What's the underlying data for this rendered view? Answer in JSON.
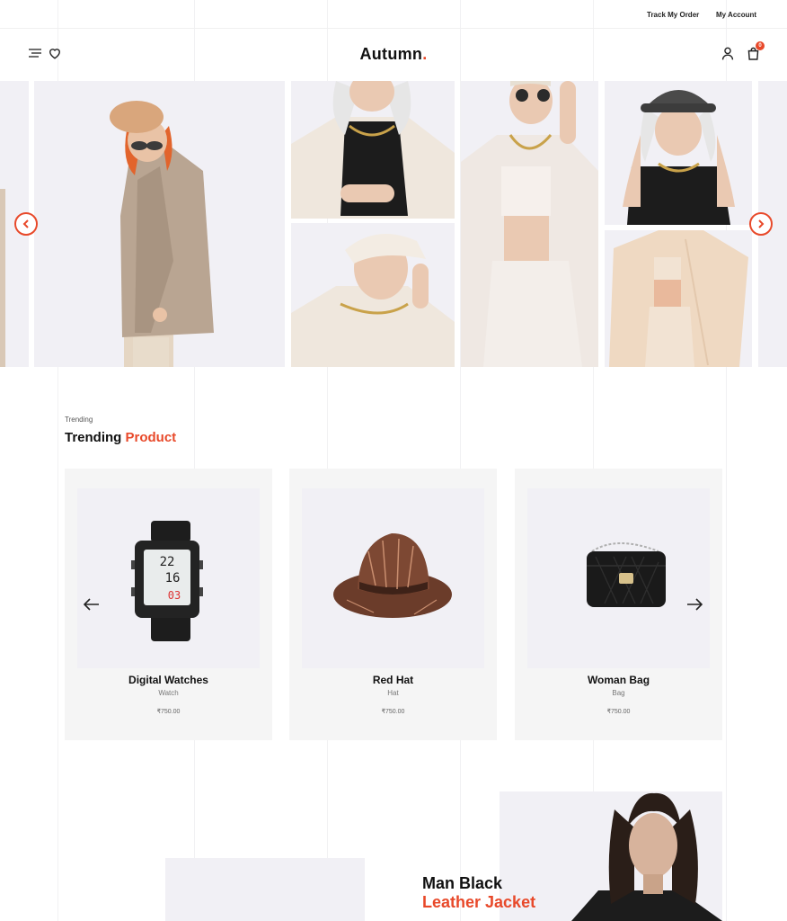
{
  "topbar": {
    "track_order": "Track My Order",
    "my_account": "My Account"
  },
  "header": {
    "logo": "Autumn",
    "logo_dot": ".",
    "cart_count": "0"
  },
  "hero": {
    "images": [
      "woman-plaid-blazer",
      "white-blazer-black-top",
      "white-hat-woman",
      "white-outfit-sunglasses",
      "bucket-hat-woman",
      "cream-suit-woman"
    ]
  },
  "trending": {
    "eyebrow": "Trending",
    "title_part1": "Trending ",
    "title_part2": "Product",
    "products": [
      {
        "name": "Digital Watches",
        "category": "Watch",
        "price": "₹750.00"
      },
      {
        "name": "Red Hat",
        "category": "Hat",
        "price": "₹750.00"
      },
      {
        "name": "Woman Bag",
        "category": "Bag",
        "price": "₹750.00"
      }
    ]
  },
  "promo": {
    "title_line1": "Man Black",
    "title_line2": "Leather Jacket"
  },
  "colors": {
    "accent": "#e8492a",
    "tile_bg": "#f1f0f5",
    "card_bg": "#f5f5f5"
  },
  "icons": [
    "menu-icon",
    "heart-icon",
    "user-icon",
    "cart-icon",
    "chevron-left-icon",
    "chevron-right-icon",
    "arrow-left-icon",
    "arrow-right-icon"
  ]
}
